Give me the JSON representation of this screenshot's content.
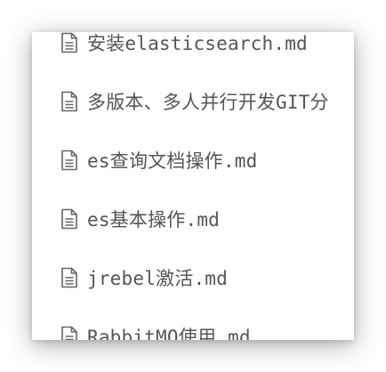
{
  "file_list": {
    "items": [
      {
        "label": "安装elasticsearch.md",
        "icon": "document-icon"
      },
      {
        "label": "多版本、多人并行开发GIT分",
        "icon": "document-icon"
      },
      {
        "label": "es查询文档操作.md",
        "icon": "document-icon"
      },
      {
        "label": "es基本操作.md",
        "icon": "document-icon"
      },
      {
        "label": "jrebel激活.md",
        "icon": "document-icon"
      },
      {
        "label": "RabbitMQ使用.md",
        "icon": "document-icon"
      }
    ]
  },
  "colors": {
    "text": "#555555",
    "icon": "#666666",
    "background": "#ffffff"
  }
}
